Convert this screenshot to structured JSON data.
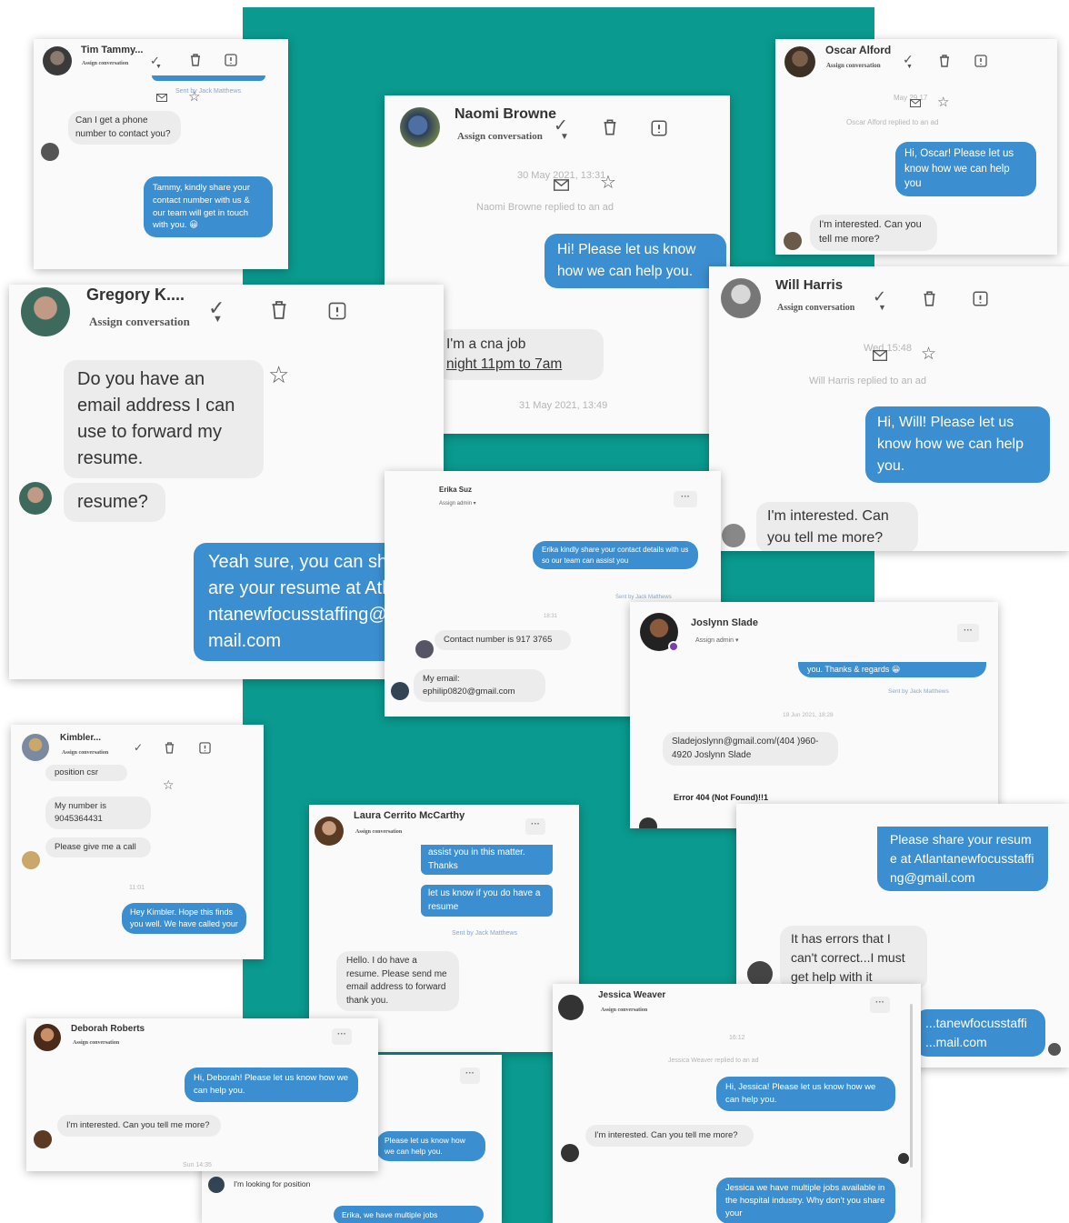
{
  "colors": {
    "teal_background": "#0a9a8f",
    "outgoing_bubble": "#3b8fd0",
    "incoming_bubble": "#ececec",
    "card_background": "#fafafa"
  },
  "icons": [
    "check-icon",
    "chevron-down-icon",
    "trash-icon",
    "report-icon",
    "star-icon",
    "envelope-icon",
    "more-icon",
    "avatar"
  ],
  "tim": {
    "name": "Tim Tammy...",
    "assign": "Assign conversation",
    "sent_by": "Sent by Jack Matthews",
    "msg_in": "Can I get a phone number to contact you?",
    "msg_out": "Tammy, kindly share your contact number with us & our team will get in touch with you. 😀"
  },
  "naomi": {
    "name": "Naomi Browne",
    "assign": "Assign conversation",
    "date1": "30 May 2021, 13:31",
    "replied": "Naomi Browne replied to an ad",
    "msg_out": "Hi! Please let us know how we can help you.",
    "msg_in_1": "I'm a cna job",
    "msg_in_2": "night 11pm to 7am",
    "date2": "31 May 2021, 13:49"
  },
  "oscar": {
    "name": "Oscar Alford",
    "assign": "Assign conversation",
    "date": "May 29 17",
    "replied": "Oscar Alford replied to an ad",
    "msg_out": "Hi, Oscar! Please let us know how we can help you",
    "msg_in": "I'm interested. Can you tell me more?"
  },
  "gregory": {
    "name": "Gregory K....",
    "assign": "Assign conversation",
    "msg_in_1": "Do you have an email address I can use to forward my resume.",
    "msg_in_2": "resume?",
    "msg_out": "Yeah sure, you can share your resume at Atlantanewfocusstaffing@gmail.com"
  },
  "will": {
    "name": "Will Harris",
    "assign": "Assign conversation",
    "date": "Wed 15:48",
    "replied": "Will Harris replied to an ad",
    "msg_out": "Hi, Will! Please let us know how we can help you.",
    "msg_in": "I'm interested. Can you tell me more?"
  },
  "erika": {
    "name": "Erika Suz",
    "assign": "Assign admin ▾",
    "msg_out": "Erika kindly share your contact details with us so our team can assist you",
    "sent_by": "Sent by Jack Matthews",
    "time": "18:31",
    "msg_in_1": "Contact number is 917 3765",
    "msg_in_2": "My email: ephilip0820@gmail.com"
  },
  "joslynn": {
    "name": "Joslynn Slade",
    "assign": "Assign admin ▾",
    "msg_top": "you. Thanks & regards 😀",
    "sent_by": "Sent by Jack Matthews",
    "date": "19 Jun 2021, 18:28",
    "msg_in": "Sladejoslynn@gmail.com/(404 )960-4920 Joslynn Slade",
    "error": "Error 404 (Not Found)!!1"
  },
  "kimbler": {
    "name": "Kimbler...",
    "assign": "Assign conversation",
    "msg_top": "position csr",
    "msg_in_1": "My number is 9045364431",
    "msg_in_2": "Please give me a call",
    "time": "11:01",
    "msg_out": "Hey Kimbler. Hope this finds you well. We have called your"
  },
  "laura": {
    "name": "Laura Cerrito McCarthy",
    "assign": "Assign conversation",
    "msg_out_1": "assist you in this matter. Thanks",
    "msg_out_2": "let us know if you do have a resume",
    "sent_by": "Sent by Jack Matthews",
    "msg_in": "Hello. I do have a resume. Please send me email address to forward thank you."
  },
  "errors": {
    "msg_out": "Please share your resume at Atlantanewfocusstaffing@gmail.com",
    "msg_in": "It has errors that I can't correct...I must get help with it",
    "msg_out_2": "...tanewfocusstaffi ...mail.com"
  },
  "deborah": {
    "name": "Deborah Roberts",
    "assign": "Assign conversation",
    "msg_out": "Hi, Deborah! Please let us know how we can help you.",
    "msg_in": "I'm interested. Can you tell me more?",
    "time": "Sun 14:35"
  },
  "hidden": {
    "msg_out": "Please let us know how we can help you.",
    "msg_in": "I'm looking for position",
    "msg_out_2": "Erika, we have multiple jobs"
  },
  "jessica": {
    "name": "Jessica Weaver",
    "assign": "Assign conversation",
    "time": "16:12",
    "replied": "Jessica Weaver replied to an ad",
    "msg_out": "Hi, Jessica! Please let us know how we can help you.",
    "msg_in": "I'm interested. Can you tell me more?",
    "msg_out_2": "Jessica we have multiple jobs available in the hospital industry. Why don't you share your"
  }
}
